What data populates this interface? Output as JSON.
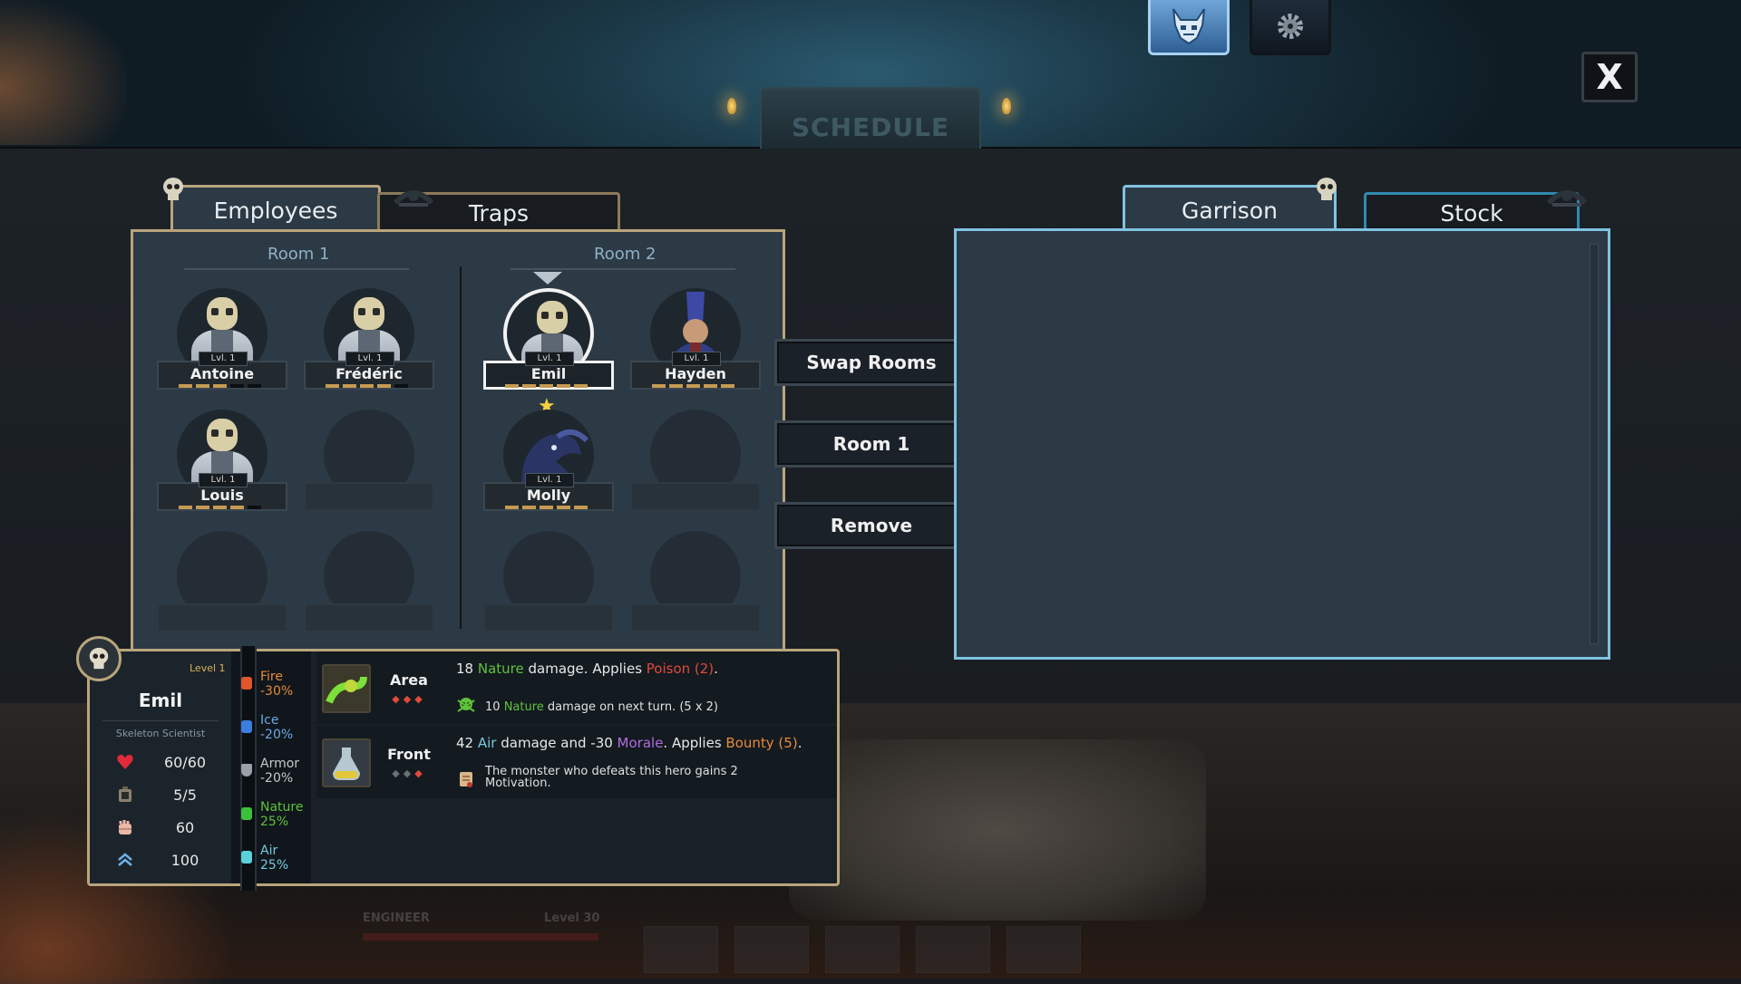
{
  "top": {
    "banner_text": "SCHEDULE",
    "close_label": "X"
  },
  "tabs_left": {
    "employees": "Employees",
    "traps": "Traps"
  },
  "tabs_right": {
    "garrison": "Garrison",
    "stock": "Stock"
  },
  "rooms": [
    {
      "label": "Room 1"
    },
    {
      "label": "Room 2"
    }
  ],
  "employees": [
    {
      "name": "Antoine",
      "level": "Lvl. 1"
    },
    {
      "name": "Frédéric",
      "level": "Lvl. 1"
    },
    {
      "name": "Louis",
      "level": "Lvl. 1"
    },
    {
      "name": "Emil",
      "level": "Lvl. 1"
    },
    {
      "name": "Hayden",
      "level": "Lvl. 1"
    },
    {
      "name": "Molly",
      "level": "Lvl. 1"
    }
  ],
  "actions": {
    "swap": "Swap Rooms",
    "room": "Room 1",
    "remove": "Remove"
  },
  "card": {
    "level": "Level 1",
    "name": "Emil",
    "class": "Skeleton Scientist",
    "hp": "60/60",
    "stamina": "5/5",
    "attack": "60",
    "speed": "100"
  },
  "resistances": [
    {
      "name": "Fire",
      "value": "-30%",
      "color": "#e68a3a"
    },
    {
      "name": "Ice",
      "value": "-20%",
      "color": "#6aa7e8"
    },
    {
      "name": "Armor",
      "value": "-20%",
      "color": "#c8c8c8"
    },
    {
      "name": "Nature",
      "value": "25%",
      "color": "#5fc23c"
    },
    {
      "name": "Air",
      "value": "25%",
      "color": "#73cbe0"
    }
  ],
  "skills": [
    {
      "target": "Area",
      "main": {
        "amount": "18",
        "element": "Nature",
        "text": " damage. Applies ",
        "effect": "Poison (2)",
        "end": "."
      },
      "sub": {
        "amount": "10",
        "element": "Nature",
        "text": " damage on next turn. (5 x 2)"
      }
    },
    {
      "target": "Front",
      "main": {
        "amount": "42",
        "element": "Air",
        "text": " damage and -30 ",
        "stat": "Morale",
        "text2": ". Applies ",
        "effect": "Bounty (5)",
        "end": "."
      },
      "sub": {
        "line1": "The monster who defeats this hero gains 2",
        "line2": "Motivation."
      }
    }
  ],
  "hud": {
    "label": "ENGINEER",
    "level": "Level 30"
  }
}
